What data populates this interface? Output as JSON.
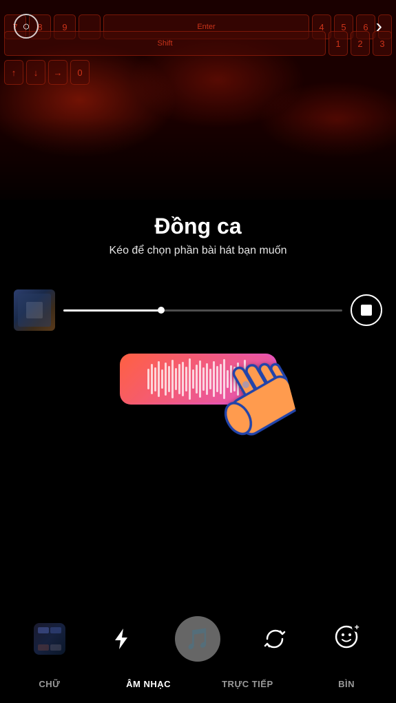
{
  "background": {
    "keyboard_visible": true
  },
  "top_bar": {
    "circle_icon": "○",
    "next_icon": "›"
  },
  "title": {
    "main": "Đồng ca",
    "subtitle": "Kéo để chọn phần bài hát bạn muốn"
  },
  "progress": {
    "fill_percent": 35,
    "stop_button_label": "stop"
  },
  "bottom_toolbar": {
    "icons": [
      "gallery",
      "flash",
      "music",
      "refresh",
      "face-effect"
    ]
  },
  "bottom_nav": {
    "tabs": [
      {
        "id": "chu",
        "label": "CHỮ",
        "active": false
      },
      {
        "id": "am-nhac",
        "label": "ÂM NHẠC",
        "active": true
      },
      {
        "id": "truc-tiep",
        "label": "TRỰC TIẾP",
        "active": false
      },
      {
        "id": "bin",
        "label": "BÌN",
        "active": false
      }
    ]
  },
  "colors": {
    "accent": "#ff6040",
    "accent2": "#cc50cc",
    "bg_dark": "#000000",
    "tab_active": "#ffffff",
    "tab_inactive": "rgba(255,255,255,0.6)"
  }
}
